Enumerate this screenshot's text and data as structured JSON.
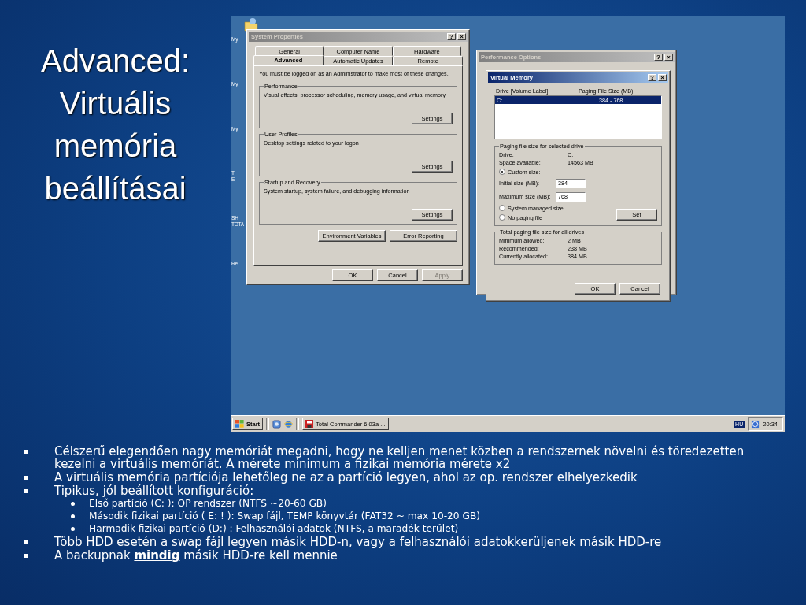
{
  "slide": {
    "title": "Advanced: Virtuális memória beállításai"
  },
  "desktop": {
    "icons": [
      {
        "lines": [
          "My"
        ]
      },
      {
        "lines": [
          "My"
        ]
      },
      {
        "lines": [
          "My"
        ]
      },
      {
        "lines": [
          "T",
          "E"
        ]
      },
      {
        "lines": [
          "SH",
          "TOTA"
        ]
      },
      {
        "lines": [
          "Re"
        ]
      }
    ]
  },
  "system_properties": {
    "title": "System Properties",
    "help_glyph": "?",
    "close_glyph": "×",
    "tab_rows": [
      [
        {
          "label": "General",
          "selected": false
        },
        {
          "label": "Computer Name",
          "selected": false
        },
        {
          "label": "Hardware",
          "selected": false
        }
      ],
      [
        {
          "label": "Advanced",
          "selected": true
        },
        {
          "label": "Automatic Updates",
          "selected": false
        },
        {
          "label": "Remote",
          "selected": false
        }
      ]
    ],
    "notice": "You must be logged on as an Administrator to make most of these changes.",
    "groups": [
      {
        "title": "Performance",
        "description": "Visual effects, processor scheduling, memory usage, and virtual memory",
        "button": "Settings"
      },
      {
        "title": "User Profiles",
        "description": "Desktop settings related to your logon",
        "button": "Settings"
      },
      {
        "title": "Startup and Recovery",
        "description": "System startup, system failure, and debugging information",
        "button": "Settings"
      }
    ],
    "action_buttons": [
      "Environment Variables",
      "Error Reporting"
    ],
    "footer_buttons": [
      {
        "label": "OK",
        "disabled": false
      },
      {
        "label": "Cancel",
        "disabled": false
      },
      {
        "label": "Apply",
        "disabled": true
      }
    ]
  },
  "performance_options": {
    "title": "Performance Options",
    "help_glyph": "?",
    "close_glyph": "×"
  },
  "virtual_memory": {
    "title": "Virtual Memory",
    "help_glyph": "?",
    "close_glyph": "×",
    "list": {
      "columns": [
        "Drive  [Volume Label]",
        "Paging File Size (MB)"
      ],
      "rows": [
        {
          "drive": "C:",
          "size": "384 - 768",
          "selected": true
        }
      ]
    },
    "drive_group": {
      "title": "Paging file size for selected drive",
      "info": [
        {
          "label": "Drive:",
          "value": "C:"
        },
        {
          "label": "Space available:",
          "value": "14563 MB"
        }
      ],
      "custom": {
        "label": "Custom size:",
        "selected": true
      },
      "fields": [
        {
          "label": "Initial size (MB):",
          "value": "384"
        },
        {
          "label": "Maximum size (MB):",
          "value": "768"
        }
      ],
      "other_options": [
        {
          "label": "System managed size",
          "selected": false
        },
        {
          "label": "No paging file",
          "selected": false
        }
      ],
      "set_button": "Set"
    },
    "totals_group": {
      "title": "Total paging file size for all drives",
      "rows": [
        {
          "label": "Minimum allowed:",
          "value": "2 MB"
        },
        {
          "label": "Recommended:",
          "value": "238 MB"
        },
        {
          "label": "Currently allocated:",
          "value": "384 MB"
        }
      ]
    },
    "footer_buttons": [
      {
        "label": "OK",
        "disabled": false
      },
      {
        "label": "Cancel",
        "disabled": false
      }
    ]
  },
  "taskbar": {
    "start": "Start",
    "task": "Total Commander 6.03a ...",
    "language": "HU",
    "clock": "20:34"
  },
  "bullets": [
    {
      "text": "Célszerű elegendően nagy memóriát megadni, hogy ne kelljen menet közben a rendszernek növelni és töredezetten kezelni a virtuális memóriát. A mérete minimum a fizikai memória mérete x2"
    },
    {
      "text": "A virtuális memória partíciója lehetőleg ne az a partíció legyen, ahol az op. rendszer elhelyezkedik"
    },
    {
      "text": "Tipikus, jól beállított konfiguráció:",
      "children": [
        {
          "text": "Első partíció (C: ): OP rendszer (NTFS ~20-60 GB)"
        },
        {
          "text": "Második fizikai partíció ( E: ! ): Swap fájl, TEMP könyvtár (FAT32 ~ max 10-20 GB)"
        },
        {
          "text": "Harmadik fizikai partíció (D:) : Felhasználói adatok (NTFS, a maradék terület)"
        }
      ]
    },
    {
      "text": "Több HDD esetén a swap fájl legyen másik HDD-n, vagy a felhasználói adatokkerüljenek másik HDD-re"
    },
    {
      "text": "A backupnak **mindig** másik HDD-re kell mennie"
    }
  ]
}
